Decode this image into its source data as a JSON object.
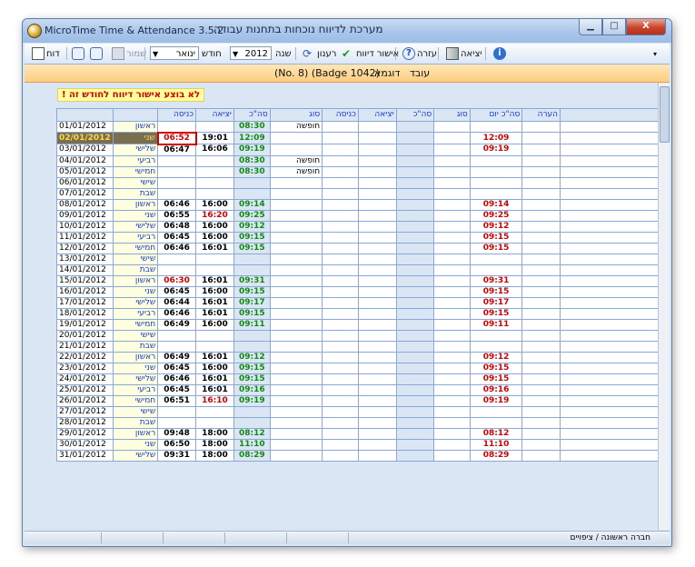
{
  "window": {
    "title_left": "MicroTime Time & Attendance 3.5.2",
    "title_right": "מערכת לדיווח נוכחות בתחנות עבודה",
    "min_label": "▁",
    "max_label": "□",
    "close_label": "X"
  },
  "toolbar": {
    "exit": "יציאה",
    "help": "עזרה",
    "approve": "אישור דיווח",
    "refresh": "רענון",
    "year_label": "שנה",
    "year_value": "2012",
    "month_label": "חודש",
    "month_value": "ינואר",
    "save": "שמור",
    "report": "דוח"
  },
  "employee": {
    "label": "עובד",
    "name": "דוגמא",
    "badge_text": "(No. 8)  (Badge 1042)"
  },
  "warning": "לא בוצע אישור דיווח לחודש זה !",
  "columns": {
    "note": "הערה",
    "day_total": "סה\"כ יום",
    "type2": "סוג",
    "total2": "סה\"כ",
    "exit2": "יציאה",
    "entry2": "כניסה",
    "type1": "סוג",
    "total1": "סה\"כ",
    "exit1": "יציאה",
    "entry1": "כניסה"
  },
  "rows": [
    {
      "date": "01/01/2012",
      "day": "ראשון",
      "in": "",
      "out": "",
      "total": "08:30",
      "type": "חופשה",
      "sum": ""
    },
    {
      "date": "02/01/2012",
      "day": "שני",
      "in": "06:52",
      "out": "19:01",
      "total": "12:09",
      "type": "",
      "sum": "12:09"
    },
    {
      "date": "03/01/2012",
      "day": "שלישי",
      "in": "06:47",
      "out": "16:06",
      "total": "09:19",
      "type": "",
      "sum": "09:19"
    },
    {
      "date": "04/01/2012",
      "day": "רביעי",
      "in": "",
      "out": "",
      "total": "08:30",
      "type": "חופשה",
      "sum": ""
    },
    {
      "date": "05/01/2012",
      "day": "חמישי",
      "in": "",
      "out": "",
      "total": "08:30",
      "type": "חופשה",
      "sum": ""
    },
    {
      "date": "06/01/2012",
      "day": "שישי",
      "in": "",
      "out": "",
      "total": "",
      "type": "",
      "sum": ""
    },
    {
      "date": "07/01/2012",
      "day": "שבת",
      "in": "",
      "out": "",
      "total": "",
      "type": "",
      "sum": ""
    },
    {
      "date": "08/01/2012",
      "day": "ראשון",
      "in": "06:46",
      "out": "16:00",
      "total": "09:14",
      "type": "",
      "sum": "09:14"
    },
    {
      "date": "09/01/2012",
      "day": "שני",
      "in": "06:55",
      "out": "16:20",
      "total": "09:25",
      "type": "",
      "sum": "09:25"
    },
    {
      "date": "10/01/2012",
      "day": "שלישי",
      "in": "06:48",
      "out": "16:00",
      "total": "09:12",
      "type": "",
      "sum": "09:12"
    },
    {
      "date": "11/01/2012",
      "day": "רביעי",
      "in": "06:45",
      "out": "16:00",
      "total": "09:15",
      "type": "",
      "sum": "09:15"
    },
    {
      "date": "12/01/2012",
      "day": "חמישי",
      "in": "06:46",
      "out": "16:01",
      "total": "09:15",
      "type": "",
      "sum": "09:15"
    },
    {
      "date": "13/01/2012",
      "day": "שישי",
      "in": "",
      "out": "",
      "total": "",
      "type": "",
      "sum": ""
    },
    {
      "date": "14/01/2012",
      "day": "שבת",
      "in": "",
      "out": "",
      "total": "",
      "type": "",
      "sum": ""
    },
    {
      "date": "15/01/2012",
      "day": "ראשון",
      "in": "06:30",
      "out": "16:01",
      "total": "09:31",
      "type": "",
      "sum": "09:31"
    },
    {
      "date": "16/01/2012",
      "day": "שני",
      "in": "06:45",
      "out": "16:00",
      "total": "09:15",
      "type": "",
      "sum": "09:15"
    },
    {
      "date": "17/01/2012",
      "day": "שלישי",
      "in": "06:44",
      "out": "16:01",
      "total": "09:17",
      "type": "",
      "sum": "09:17"
    },
    {
      "date": "18/01/2012",
      "day": "רביעי",
      "in": "06:46",
      "out": "16:01",
      "total": "09:15",
      "type": "",
      "sum": "09:15"
    },
    {
      "date": "19/01/2012",
      "day": "חמישי",
      "in": "06:49",
      "out": "16:00",
      "total": "09:11",
      "type": "",
      "sum": "09:11"
    },
    {
      "date": "20/01/2012",
      "day": "שישי",
      "in": "",
      "out": "",
      "total": "",
      "type": "",
      "sum": ""
    },
    {
      "date": "21/01/2012",
      "day": "שבת",
      "in": "",
      "out": "",
      "total": "",
      "type": "",
      "sum": ""
    },
    {
      "date": "22/01/2012",
      "day": "ראשון",
      "in": "06:49",
      "out": "16:01",
      "total": "09:12",
      "type": "",
      "sum": "09:12"
    },
    {
      "date": "23/01/2012",
      "day": "שני",
      "in": "06:45",
      "out": "16:00",
      "total": "09:15",
      "type": "",
      "sum": "09:15"
    },
    {
      "date": "24/01/2012",
      "day": "שלישי",
      "in": "06:46",
      "out": "16:01",
      "total": "09:15",
      "type": "",
      "sum": "09:15"
    },
    {
      "date": "25/01/2012",
      "day": "רביעי",
      "in": "06:45",
      "out": "16:01",
      "total": "09:16",
      "type": "",
      "sum": "09:16"
    },
    {
      "date": "26/01/2012",
      "day": "חמישי",
      "in": "06:51",
      "out": "16:10",
      "total": "09:19",
      "type": "",
      "sum": "09:19"
    },
    {
      "date": "27/01/2012",
      "day": "שישי",
      "in": "",
      "out": "",
      "total": "",
      "type": "",
      "sum": ""
    },
    {
      "date": "28/01/2012",
      "day": "שבת",
      "in": "",
      "out": "",
      "total": "",
      "type": "",
      "sum": ""
    },
    {
      "date": "29/01/2012",
      "day": "ראשון",
      "in": "09:48",
      "out": "18:00",
      "total": "08:12",
      "type": "",
      "sum": "08:12"
    },
    {
      "date": "30/01/2012",
      "day": "שני",
      "in": "06:50",
      "out": "18:00",
      "total": "11:10",
      "type": "",
      "sum": "11:10"
    },
    {
      "date": "31/01/2012",
      "day": "שלישי",
      "in": "09:31",
      "out": "18:00",
      "total": "08:29",
      "type": "",
      "sum": "08:29"
    }
  ],
  "status": {
    "company": "חברה ראשונה / ציפויים"
  },
  "colors": {
    "accent_blue": "#1a3bd1",
    "late_red": "#d00000",
    "total_green": "#118a11"
  }
}
